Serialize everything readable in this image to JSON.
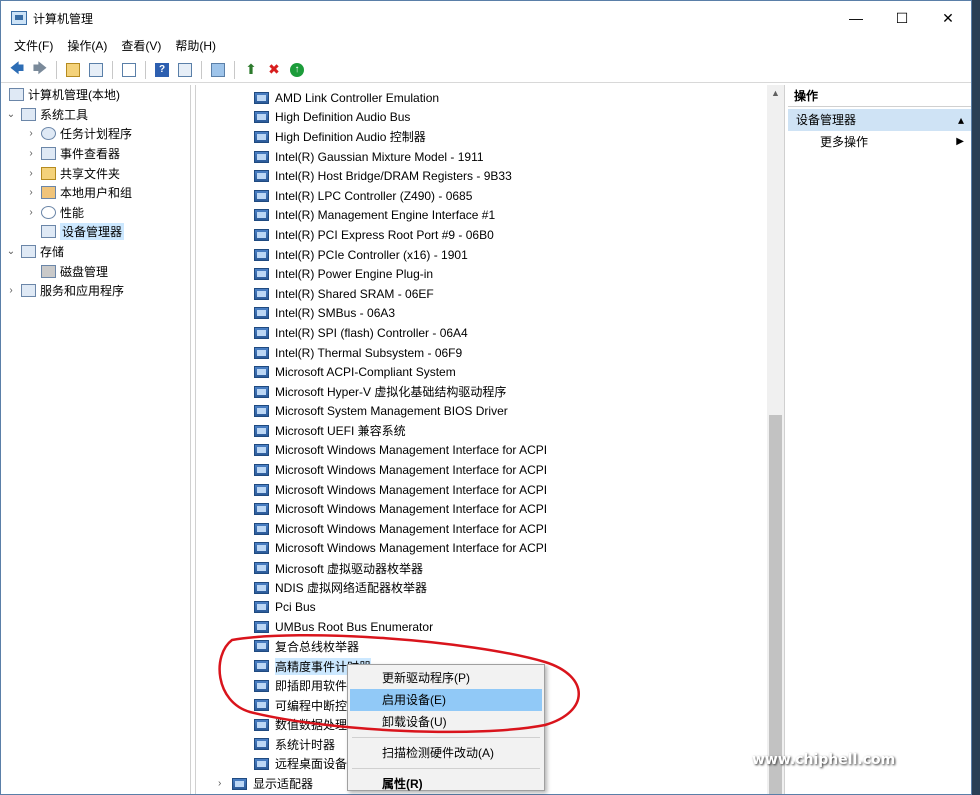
{
  "window": {
    "title": "计算机管理",
    "controls": {
      "minimize": "—",
      "maximize": "☐",
      "close": "✕"
    }
  },
  "menubar": [
    "文件(F)",
    "操作(A)",
    "查看(V)",
    "帮助(H)"
  ],
  "left_tree": {
    "root": "计算机管理(本地)",
    "system_tools": "系统工具",
    "children": [
      "任务计划程序",
      "事件查看器",
      "共享文件夹",
      "本地用户和组",
      "性能",
      "设备管理器"
    ],
    "storage": "存储",
    "disk_mgmt": "磁盘管理",
    "services": "服务和应用程序"
  },
  "devices": [
    "AMD Link Controller Emulation",
    "High Definition Audio Bus",
    "High Definition Audio 控制器",
    "Intel(R) Gaussian Mixture Model - 1911",
    "Intel(R) Host Bridge/DRAM Registers - 9B33",
    "Intel(R) LPC Controller (Z490) - 0685",
    "Intel(R) Management Engine Interface #1",
    "Intel(R) PCI Express Root Port #9 - 06B0",
    "Intel(R) PCIe Controller (x16) - 1901",
    "Intel(R) Power Engine Plug-in",
    "Intel(R) Shared SRAM - 06EF",
    "Intel(R) SMBus - 06A3",
    "Intel(R) SPI (flash) Controller - 06A4",
    "Intel(R) Thermal Subsystem - 06F9",
    "Microsoft ACPI-Compliant System",
    "Microsoft Hyper-V 虚拟化基础结构驱动程序",
    "Microsoft System Management BIOS Driver",
    "Microsoft UEFI 兼容系统",
    "Microsoft Windows Management Interface for ACPI",
    "Microsoft Windows Management Interface for ACPI",
    "Microsoft Windows Management Interface for ACPI",
    "Microsoft Windows Management Interface for ACPI",
    "Microsoft Windows Management Interface for ACPI",
    "Microsoft Windows Management Interface for ACPI",
    "Microsoft 虚拟驱动器枚举器",
    "NDIS 虚拟网络适配器枚举器",
    "Pci Bus",
    "UMBus Root Bus Enumerator",
    "复合总线枚举器",
    "高精度事件计时器",
    "即插即用软件",
    "可编程中断控",
    "数值数据处理",
    "系统计时器",
    "远程桌面设备"
  ],
  "display_adapters": "显示适配器",
  "actions": {
    "header": "操作",
    "section": "设备管理器",
    "more": "更多操作"
  },
  "context_menu": {
    "update_driver": "更新驱动程序(P)",
    "enable_device": "启用设备(E)",
    "uninstall_device": "卸载设备(U)",
    "scan_hardware": "扫描检测硬件改动(A)",
    "properties": "属性(R)"
  },
  "watermark": {
    "logo": "chip hell",
    "url": "www.chiphell.com"
  },
  "colors": {
    "selection": "#cce8ff",
    "menu_active": "#91c9f7",
    "annotation": "#d9141c"
  }
}
